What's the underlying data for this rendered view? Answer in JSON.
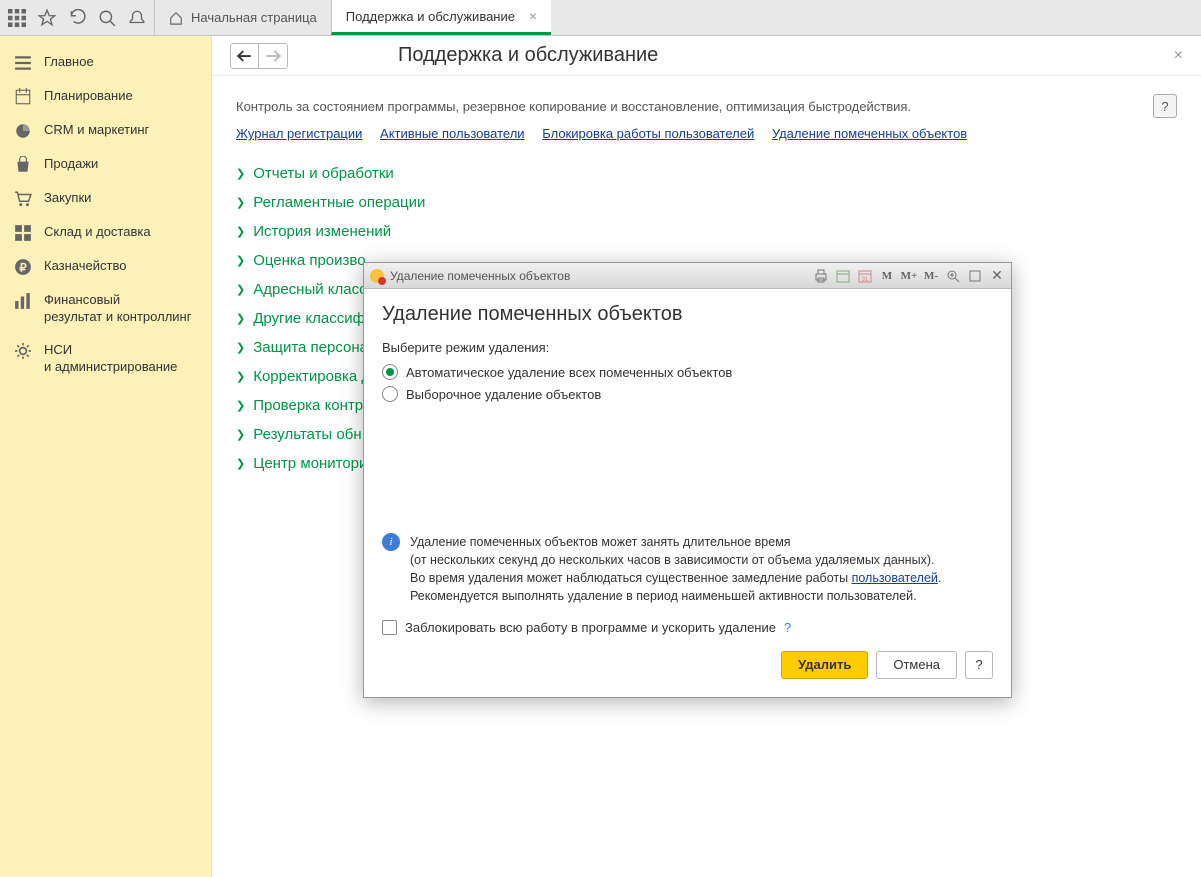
{
  "tabs": {
    "home": "Начальная страница",
    "support": "Поддержка и обслуживание"
  },
  "sidebar": {
    "items": [
      {
        "label": "Главное",
        "icon": "menu"
      },
      {
        "label": "Планирование",
        "icon": "plan"
      },
      {
        "label": "CRM и маркетинг",
        "icon": "pie"
      },
      {
        "label": "Продажи",
        "icon": "bag"
      },
      {
        "label": "Закупки",
        "icon": "cart"
      },
      {
        "label": "Склад и доставка",
        "icon": "boxes"
      },
      {
        "label": "Казначейство",
        "icon": "ruble"
      },
      {
        "label": "Финансовый\nрезультат и контроллинг",
        "icon": "bars"
      },
      {
        "label": "НСИ\nи администрирование",
        "icon": "gear"
      }
    ]
  },
  "page": {
    "title": "Поддержка и обслуживание",
    "desc": "Контроль за состоянием программы, резервное копирование и восстановление, оптимизация быстродействия.",
    "links": [
      "Журнал регистрации",
      "Активные пользователи",
      "Блокировка работы пользователей",
      "Удаление помеченных объектов"
    ],
    "groups": [
      "Отчеты и обработки",
      "Регламентные операции",
      "История изменений",
      "Оценка произво",
      "Адресный класс",
      "Другие классиф",
      "Защита персона",
      "Корректировка д",
      "Проверка контр",
      "Результаты обн",
      "Центр монитори"
    ]
  },
  "modal": {
    "wintitle": "Удаление помеченных объектов",
    "mbtns": [
      "M",
      "M+",
      "M-"
    ],
    "title": "Удаление помеченных объектов",
    "prompt": "Выберите режим удаления:",
    "opt1": "Автоматическое удаление всех помеченных объектов",
    "opt2": "Выборочное удаление объектов",
    "info1": "Удаление помеченных объектов может занять длительное время",
    "info2": "(от нескольких секунд до нескольких часов в зависимости от объема удаляемых данных).",
    "info3a": "Во время удаления может наблюдаться существенное замедление работы ",
    "info3link": "пользователей",
    "info3b": ".",
    "info4": "Рекомендуется выполнять удаление в период наименьшей активности пользователей.",
    "check": "Заблокировать всю работу в программе и ускорить удаление",
    "checkq": "?",
    "btn_delete": "Удалить",
    "btn_cancel": "Отмена",
    "btn_help": "?"
  }
}
